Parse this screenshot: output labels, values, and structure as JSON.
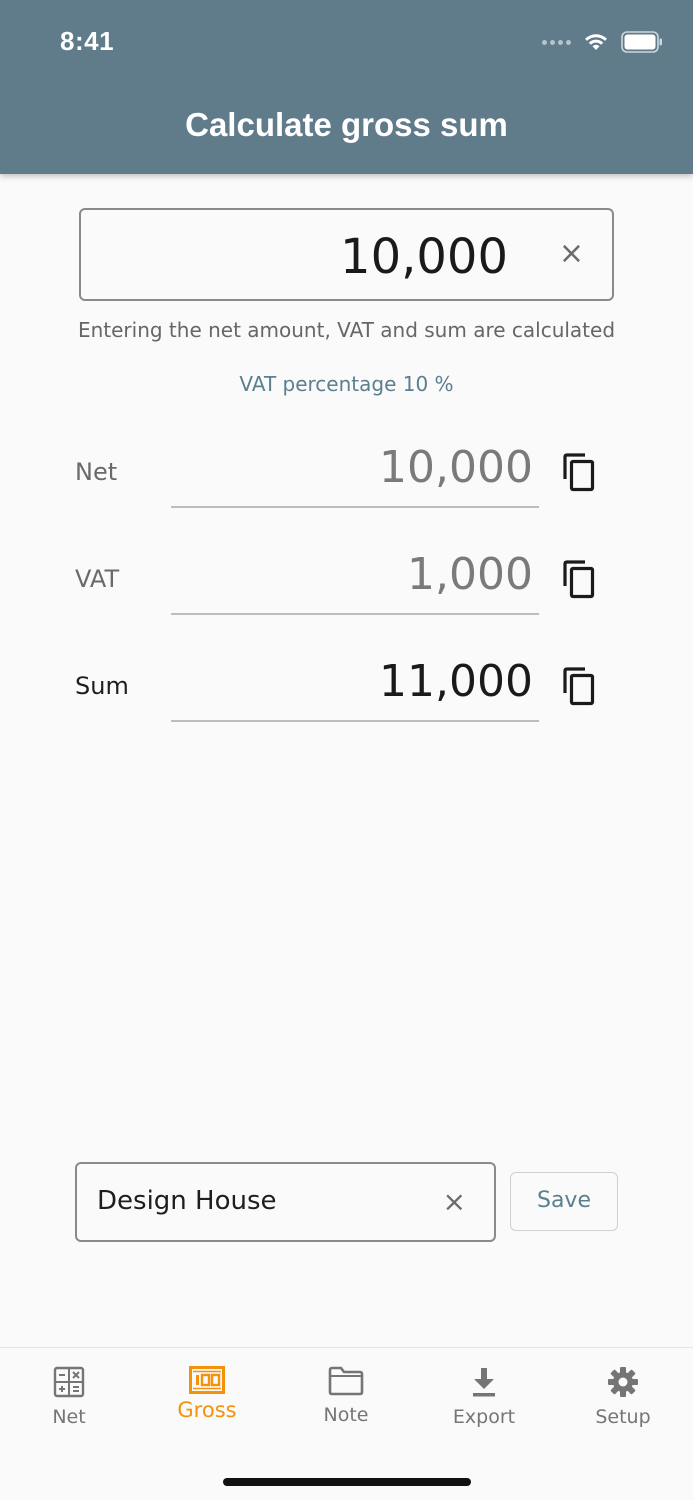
{
  "status_bar": {
    "time": "8:41"
  },
  "header": {
    "title": "Calculate gross sum"
  },
  "main_input": {
    "value": "10,000",
    "clear_icon": "×"
  },
  "helper_text": "Entering the net amount, VAT and sum are calculated",
  "vat_link": "VAT percentage 10 %",
  "results": [
    {
      "label": "Net",
      "value": "10,000"
    },
    {
      "label": "VAT",
      "value": "1,000"
    },
    {
      "label": "Sum",
      "value": "11,000"
    }
  ],
  "note": {
    "value": "Design House",
    "clear_icon": "×",
    "save_label": "Save"
  },
  "nav": {
    "active_color": "#f5920a",
    "items": [
      {
        "label": "Net",
        "icon": "calculator-icon"
      },
      {
        "label": "Gross",
        "icon": "gross-100-icon"
      },
      {
        "label": "Note",
        "icon": "folder-icon"
      },
      {
        "label": "Export",
        "icon": "download-icon"
      },
      {
        "label": "Setup",
        "icon": "gear-icon"
      }
    ]
  },
  "colors": {
    "header_bg": "#607b8a",
    "accent_link": "#5c7f8f"
  }
}
